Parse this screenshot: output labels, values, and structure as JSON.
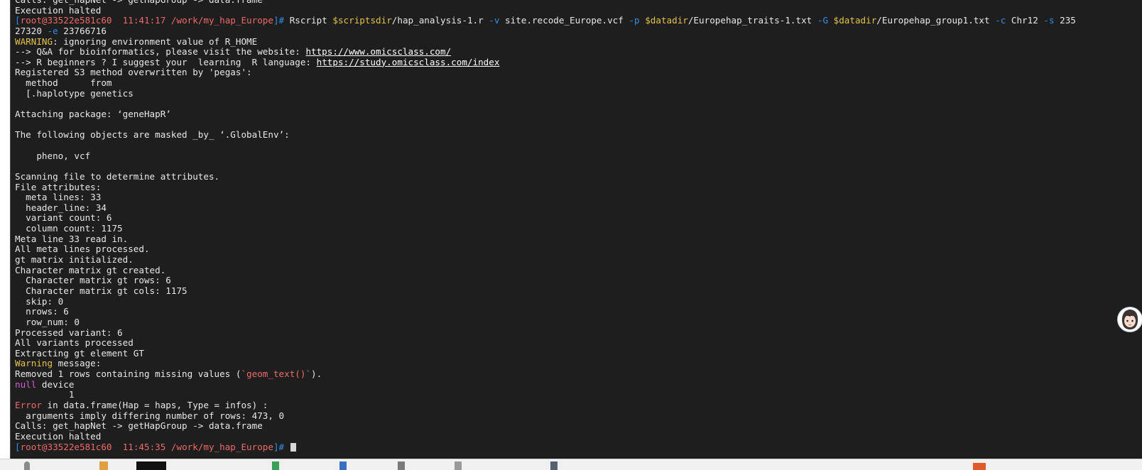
{
  "terminal": {
    "lines": [
      [
        {
          "t": "Calls: get_hapNet -> getHapGroup -> data.frame"
        }
      ],
      [
        {
          "t": "Execution halted"
        }
      ],
      [
        {
          "t": "[",
          "c": "blue"
        },
        {
          "t": "root@33522e581c60",
          "c": "salmon"
        },
        {
          "t": "  11:41:17 /work/my_hap_Europe",
          "c": "salmon"
        },
        {
          "t": "]# ",
          "c": "blue"
        },
        {
          "t": "Rscript "
        },
        {
          "t": "$scriptsdir",
          "c": "yellow"
        },
        {
          "t": "/hap_analysis-1.r "
        },
        {
          "t": "-v",
          "c": "blue"
        },
        {
          "t": " site.recode_Europe.vcf "
        },
        {
          "t": "-p",
          "c": "blue"
        },
        {
          "t": " "
        },
        {
          "t": "$datadir",
          "c": "yellow"
        },
        {
          "t": "/Europehap_traits-1.txt "
        },
        {
          "t": "-G",
          "c": "blue"
        },
        {
          "t": " "
        },
        {
          "t": "$datadir",
          "c": "yellow"
        },
        {
          "t": "/Europehap_group1.txt "
        },
        {
          "t": "-c",
          "c": "blue"
        },
        {
          "t": " Chr12 "
        },
        {
          "t": "-s",
          "c": "blue"
        },
        {
          "t": " 235"
        }
      ],
      [
        {
          "t": "27320 "
        },
        {
          "t": "-e",
          "c": "blue"
        },
        {
          "t": " 23766716"
        }
      ],
      [
        {
          "t": "WARNING",
          "c": "yellow"
        },
        {
          "t": ": ignoring environment value of R_HOME"
        }
      ],
      [
        {
          "t": "--> Q&A for bioinformatics, please visit the website: "
        },
        {
          "t": "https://www.omicsclass.com/",
          "c": "link"
        }
      ],
      [
        {
          "t": "--> R beginners ? I suggest your  learning  R language: "
        },
        {
          "t": "https://study.omicsclass.com/index",
          "c": "link"
        }
      ],
      [
        {
          "t": "Registered S3 method overwritten by 'pegas':"
        }
      ],
      [
        {
          "t": "  method      from"
        }
      ],
      [
        {
          "t": "  [.haplotype genetics"
        }
      ],
      [
        {
          "t": ""
        }
      ],
      [
        {
          "t": "Attaching package: ‘geneHapR’"
        }
      ],
      [
        {
          "t": ""
        }
      ],
      [
        {
          "t": "The following objects are masked _by_ ‘.GlobalEnv’:"
        }
      ],
      [
        {
          "t": ""
        }
      ],
      [
        {
          "t": "    pheno, vcf"
        }
      ],
      [
        {
          "t": ""
        }
      ],
      [
        {
          "t": "Scanning file to determine attributes."
        }
      ],
      [
        {
          "t": "File attributes:"
        }
      ],
      [
        {
          "t": "  meta lines: 33"
        }
      ],
      [
        {
          "t": "  header_line: 34"
        }
      ],
      [
        {
          "t": "  variant count: 6"
        }
      ],
      [
        {
          "t": "  column count: 1175"
        }
      ],
      [
        {
          "t": "Meta line 33 read in."
        }
      ],
      [
        {
          "t": "All meta lines processed."
        }
      ],
      [
        {
          "t": "gt matrix initialized."
        }
      ],
      [
        {
          "t": "Character matrix gt created."
        }
      ],
      [
        {
          "t": "  Character matrix gt rows: 6"
        }
      ],
      [
        {
          "t": "  Character matrix gt cols: 1175"
        }
      ],
      [
        {
          "t": "  skip: 0"
        }
      ],
      [
        {
          "t": "  nrows: 6"
        }
      ],
      [
        {
          "t": "  row_num: 0"
        }
      ],
      [
        {
          "t": "Processed variant: 6"
        }
      ],
      [
        {
          "t": "All variants processed"
        }
      ],
      [
        {
          "t": "Extracting gt element GT"
        }
      ],
      [
        {
          "t": "Warning",
          "c": "yellow"
        },
        {
          "t": " message:"
        }
      ],
      [
        {
          "t": "Removed 1 rows containing missing values ("
        },
        {
          "t": "`geom_text()`",
          "c": "salmon"
        },
        {
          "t": ")."
        }
      ],
      [
        {
          "t": "null",
          "c": "magenta"
        },
        {
          "t": " device"
        }
      ],
      [
        {
          "t": "          1"
        }
      ],
      [
        {
          "t": "Error",
          "c": "salmon"
        },
        {
          "t": " in data.frame(Hap = haps, Type = infos) :"
        }
      ],
      [
        {
          "t": "  arguments imply differing number of rows: 473, 0"
        }
      ],
      [
        {
          "t": "Calls: get_hapNet -> getHapGroup -> data.frame"
        }
      ],
      [
        {
          "t": "Execution halted"
        }
      ],
      [
        {
          "t": "[",
          "c": "blue"
        },
        {
          "t": "root@33522e581c60",
          "c": "salmon"
        },
        {
          "t": "  11:45:35 /work/my_hap_Europe",
          "c": "salmon"
        },
        {
          "t": "]# ",
          "c": "blue"
        },
        {
          "cursor": true
        }
      ]
    ]
  },
  "colors": {
    "background": "#1e1e1e",
    "text": "#e8e8e8",
    "blue": "#2f8fe8",
    "salmon": "#ef6a6a",
    "yellow": "#e5c24c",
    "magenta": "#d55ad5"
  },
  "icons": {
    "assistant": "assistant-avatar-icon"
  }
}
